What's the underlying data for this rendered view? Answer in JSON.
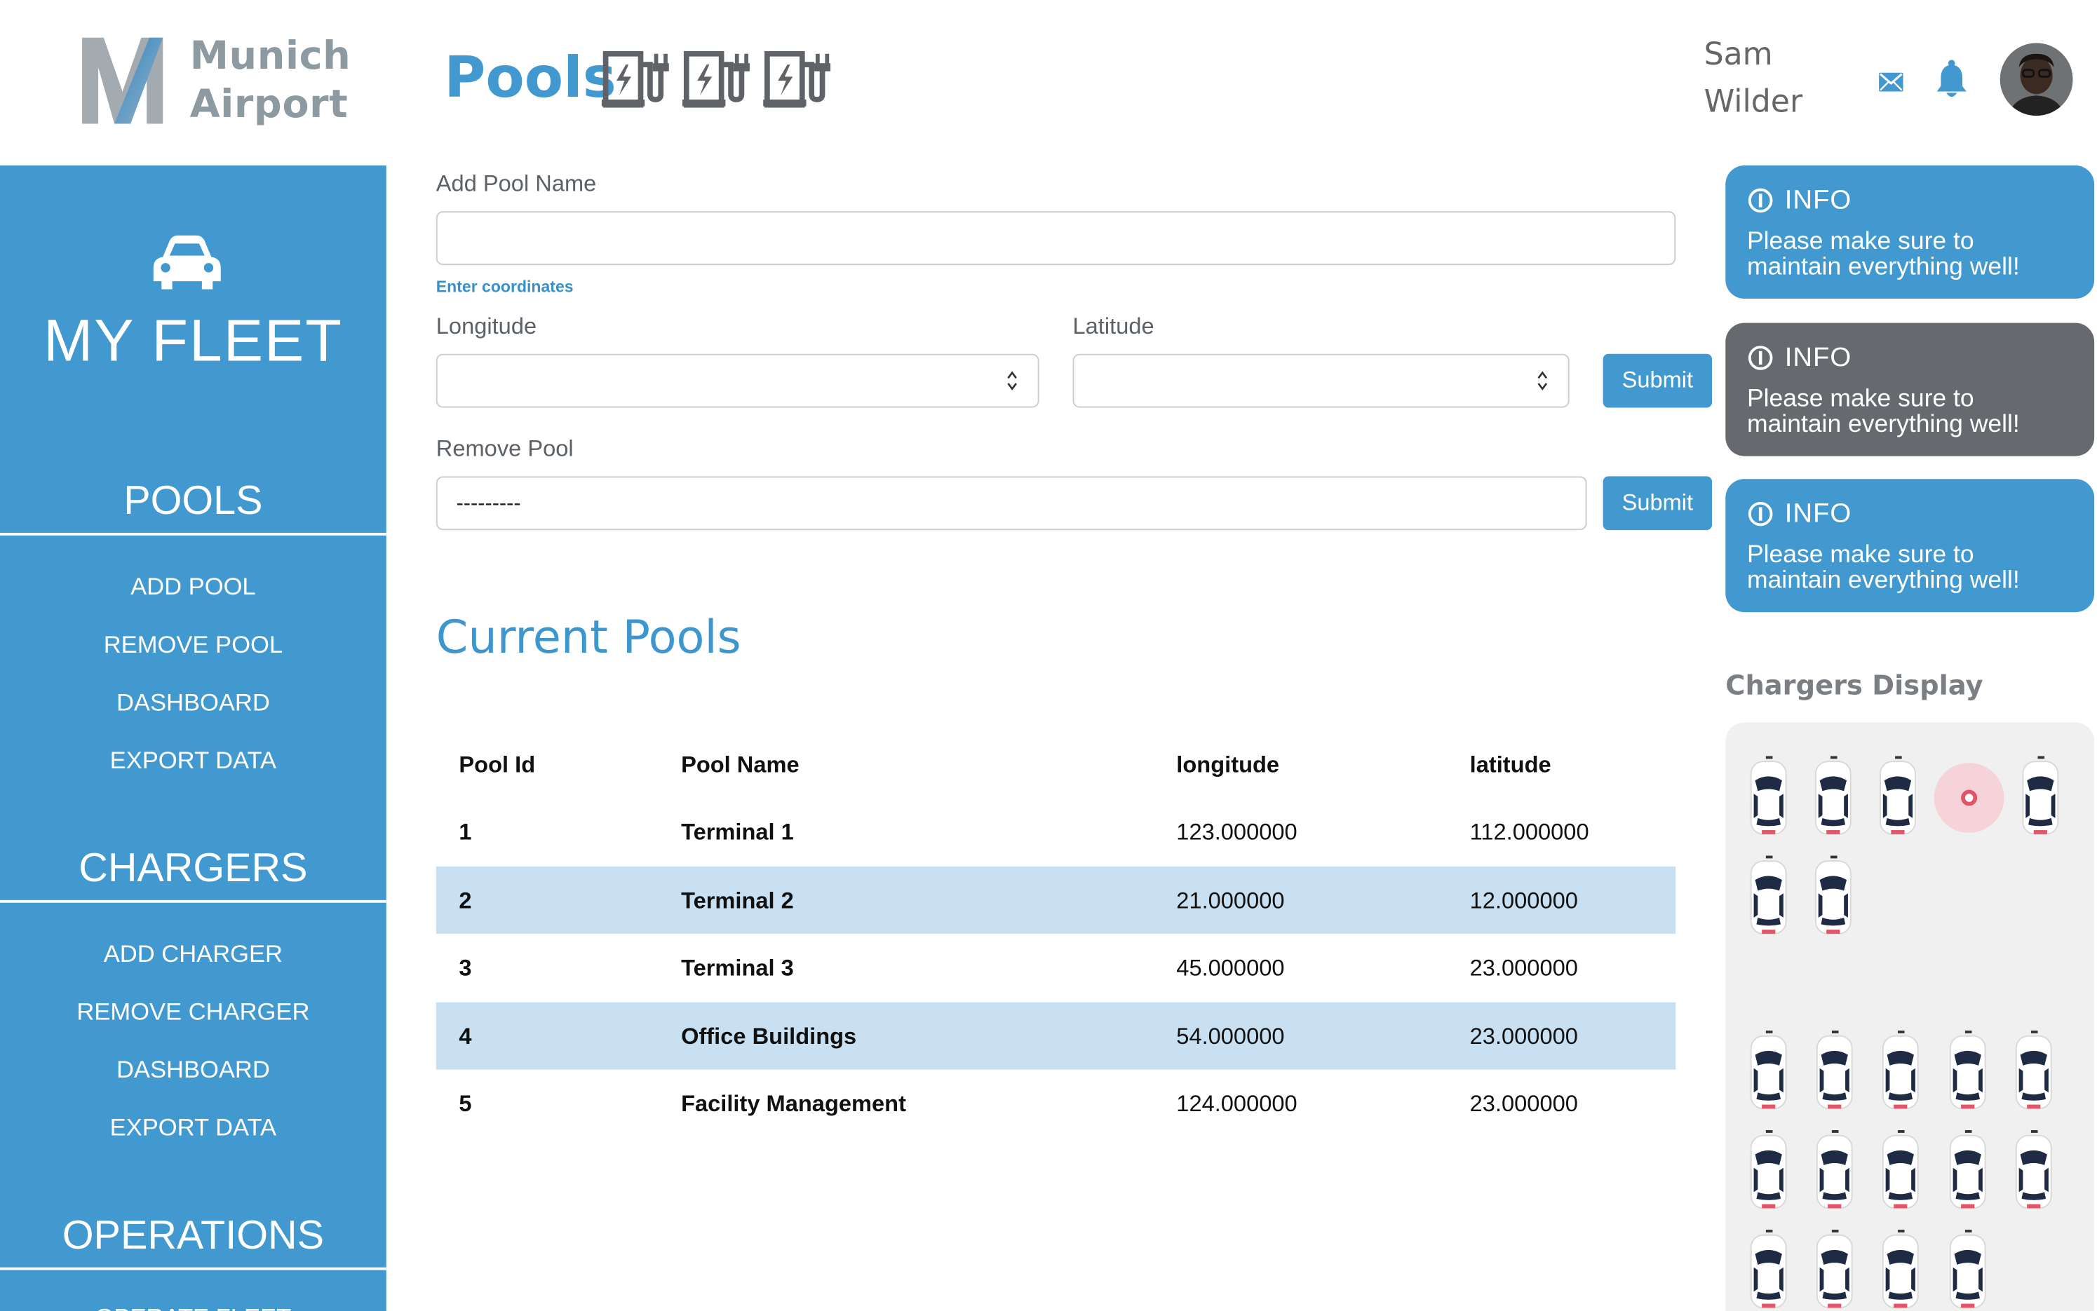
{
  "logo": {
    "line1": "Munich",
    "line2": "Airport"
  },
  "sidebar": {
    "brand": "MY FLEET",
    "sections": [
      {
        "title": "POOLS",
        "items": [
          "ADD POOL",
          "REMOVE POOL",
          "DASHBOARD",
          "EXPORT DATA"
        ]
      },
      {
        "title": "CHARGERS",
        "items": [
          "ADD CHARGER",
          "REMOVE CHARGER",
          "DASHBOARD",
          "EXPORT DATA"
        ]
      },
      {
        "title": "OPERATIONS",
        "items": [
          "OPERATE FLEET"
        ]
      }
    ]
  },
  "header": {
    "title": "Pools",
    "user_first": "Sam",
    "user_last": "Wilder"
  },
  "form": {
    "add_pool_label": "Add Pool Name",
    "add_pool_value": "",
    "coords_hint": "Enter coordinates",
    "longitude_label": "Longitude",
    "latitude_label": "Latitude",
    "submit_label": "Submit",
    "remove_pool_label": "Remove Pool",
    "remove_pool_selected": "---------"
  },
  "current_pools": {
    "title": "Current Pools",
    "columns": [
      "Pool Id",
      "Pool Name",
      "longitude",
      "latitude"
    ],
    "rows": [
      [
        "1",
        "Terminal 1",
        "123.000000",
        "112.000000"
      ],
      [
        "2",
        "Terminal 2",
        "21.000000",
        "12.000000"
      ],
      [
        "3",
        "Terminal 3",
        "45.000000",
        "23.000000"
      ],
      [
        "4",
        "Office Buildings",
        "54.000000",
        "23.000000"
      ],
      [
        "5",
        "Facility Management",
        "124.000000",
        "23.000000"
      ]
    ]
  },
  "info_cards": [
    {
      "title": "INFO",
      "text": "Please make sure to maintain everything well!",
      "color": "#4199d0"
    },
    {
      "title": "INFO",
      "text": "Please make sure to maintain everything well!",
      "color": "#666a6e"
    },
    {
      "title": "INFO",
      "text": "Please make sure to maintain everything well!",
      "color": "#4199d0"
    }
  ],
  "chargers_display": {
    "title": "Chargers Display"
  },
  "colors": {
    "accent": "#4199d0",
    "row_alt": "#c8e0f1",
    "alert_dot": "#e05668"
  },
  "icons": [
    "car-icon",
    "ev-charger-icon",
    "mail-icon",
    "bell-icon",
    "info-icon",
    "spinner-arrows-icon"
  ]
}
